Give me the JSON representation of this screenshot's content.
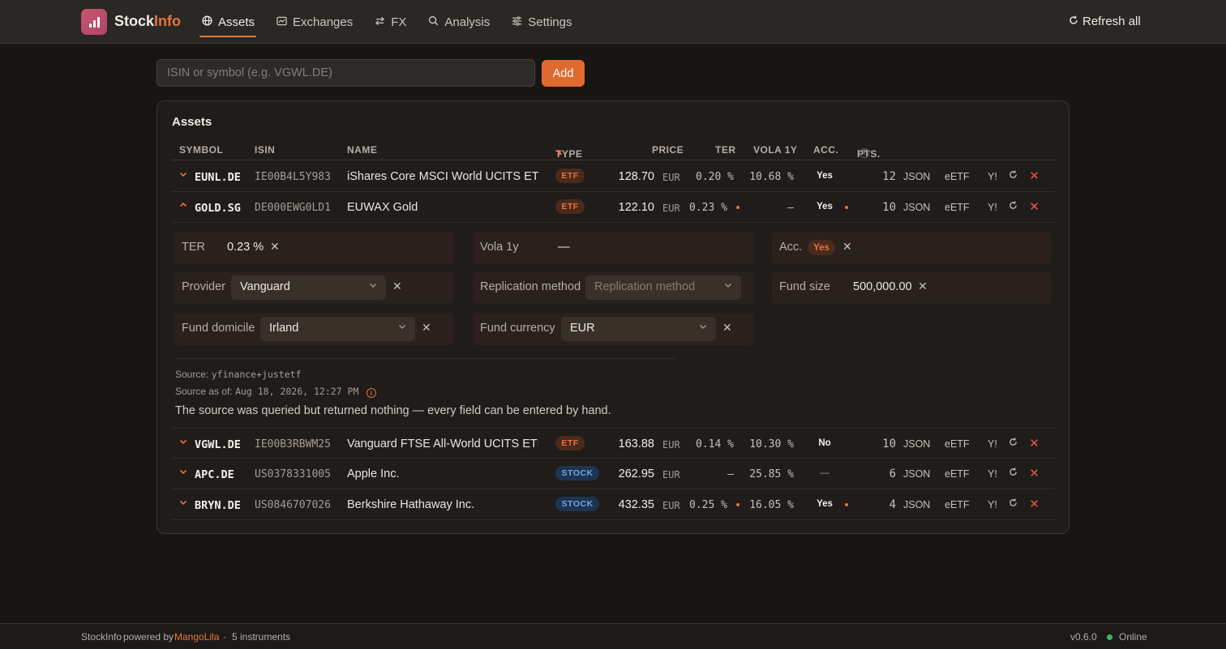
{
  "app": {
    "brand_a": "Stock",
    "brand_b": "Info",
    "logo_icon": "bar-chart-icon",
    "accent_color": "#e8743a"
  },
  "nav": {
    "items": [
      {
        "label": "Assets",
        "icon": "globe-icon",
        "active": true
      },
      {
        "label": "Exchanges",
        "icon": "chart-card-icon",
        "active": false
      },
      {
        "label": "FX",
        "icon": "swap-icon",
        "active": false
      },
      {
        "label": "Analysis",
        "icon": "search-icon",
        "active": false
      },
      {
        "label": "Settings",
        "icon": "sliders-icon",
        "active": false
      }
    ],
    "refresh_all": "Refresh all"
  },
  "search": {
    "placeholder": "ISIN or symbol (e.g. VGWL.DE)",
    "value": "",
    "add_label": "Add"
  },
  "panel": {
    "title": "Assets",
    "columns": {
      "symbol": "SYMBOL",
      "isin": "ISIN",
      "name": "NAME",
      "type": "TYPE",
      "price": "PRICE",
      "ter": "TER",
      "vola": "VOLA 1Y",
      "acc": "ACC.",
      "pts": "PTS.",
      "pts_help": "?",
      "sort_arrow": "▲"
    },
    "actions": {
      "json": "JSON",
      "etf": "eETF",
      "yahoo": "Y!"
    },
    "rows": [
      {
        "symbol": "EUNL.DE",
        "isin": "IE00B4L5Y983",
        "name": "iShares Core MSCI World UCITS ET...",
        "type": "ETF",
        "price": "128.70",
        "currency": "EUR",
        "ter": "0.20 %",
        "vola": "10.68 %",
        "acc": "Yes",
        "pts": "12",
        "expanded": false
      },
      {
        "symbol": "GOLD.SG",
        "isin": "DE000EWG0LD1",
        "name": "EUWAX Gold",
        "type": "ETF",
        "price": "122.10",
        "currency": "EUR",
        "ter": "0.23 %",
        "vola": "—",
        "acc": "Yes",
        "pts": "10",
        "expanded": true
      },
      {
        "symbol": "VGWL.DE",
        "isin": "IE00B3RBWM25",
        "name": "Vanguard FTSE All-World UCITS ETF",
        "type": "ETF",
        "price": "163.88",
        "currency": "EUR",
        "ter": "0.14 %",
        "vola": "10.30 %",
        "acc": "No",
        "pts": "10",
        "expanded": false
      },
      {
        "symbol": "APC.DE",
        "isin": "US0378331005",
        "name": "Apple Inc.",
        "type": "STOCK",
        "price": "262.95",
        "currency": "EUR",
        "ter": "—",
        "vola": "25.85 %",
        "acc": "—",
        "pts": "6",
        "expanded": false
      },
      {
        "symbol": "BRYN.DE",
        "isin": "US0846707026",
        "name": "Berkshire Hathaway Inc.",
        "type": "STOCK",
        "price": "432.35",
        "currency": "EUR",
        "ter": "0.25 %",
        "vola": "16.05 %",
        "acc": "Yes",
        "pts": "4",
        "expanded": false
      }
    ],
    "detail": {
      "ter_label": "TER",
      "ter_value": "0.23 %",
      "vola_label": "Vola 1y",
      "vola_value": "—",
      "acc_label": "Acc.",
      "acc_value": "Yes",
      "provider_label": "Provider",
      "provider_value": "Vanguard",
      "replication_label": "Replication method",
      "replication_placeholder": "Replication method",
      "fund_size_label": "Fund size",
      "fund_size_value": "500,000.00",
      "domicile_label": "Fund domicile",
      "domicile_value": "Irland",
      "currency_label": "Fund currency",
      "currency_value": "EUR",
      "source_label": "Source:",
      "source_value": "yfinance+justetf",
      "source_asof_label": "Source as of:",
      "source_asof_value": "Aug 18, 2026, 12:27 PM",
      "note": "The source was queried but returned nothing — every field can be entered by hand."
    }
  },
  "footer": {
    "brand": "StockInfo",
    "powered_by": "powered by",
    "author": "MangoLila",
    "sep": "·",
    "instruments": "5 instruments",
    "version": "v0.6.0",
    "status": "Online",
    "status_color": "#3fb36b"
  }
}
